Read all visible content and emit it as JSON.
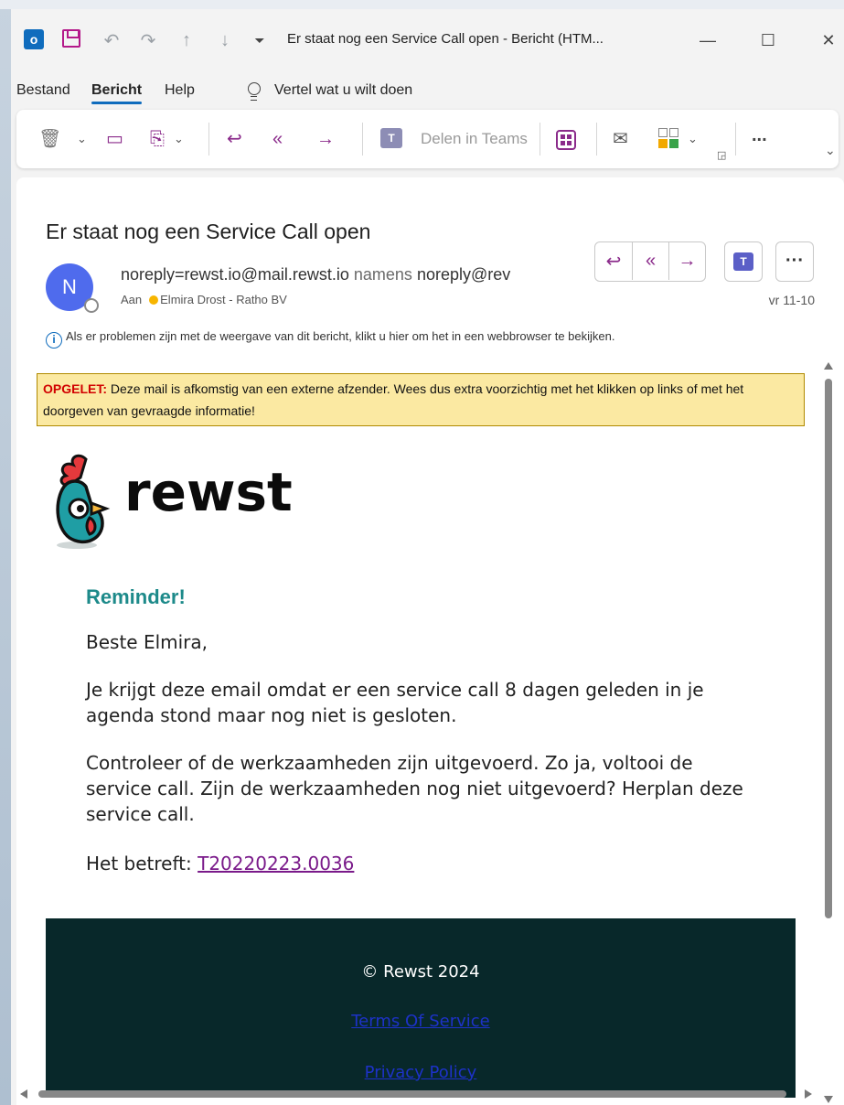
{
  "window": {
    "title": "Er staat nog een Service Call open  -  Bericht (HTM..."
  },
  "menu": {
    "items": [
      "Bestand",
      "Bericht",
      "Help"
    ],
    "tell_me": "Vertel wat u wilt doen"
  },
  "ribbon": {
    "share_teams_label": "Delen in Teams",
    "more_label": "..."
  },
  "message": {
    "subject": "Er staat nog een Service Call open",
    "avatar_initial": "N",
    "sender_address": "noreply=rewst.io@mail.rewst.io",
    "sender_on_behalf": "namens",
    "sender_behalf_address": "noreply@rev",
    "to_label": "Aan",
    "recipient": "Elmira Drost - Ratho BV",
    "date": "vr 11-10",
    "info_text": "Als er problemen zijn met de weergave van dit bericht, klikt u hier om het in een webbrowser te bekijken.",
    "info_icon": "i"
  },
  "body": {
    "warning_label": "OPGELET:",
    "warning_text": " Deze mail is afkomstig van een externe afzender. Wees dus extra voorzichtig met het klikken op links of met het doorgeven van gevraagde informatie!",
    "logo_text": "rewst",
    "heading": "Reminder!",
    "greeting": "Beste Elmira,",
    "para1": "Je krijgt deze email omdat er een service call 8 dagen geleden in je agenda stond maar nog niet is gesloten.",
    "para2": "Controleer of de werkzaamheden zijn uitgevoerd. Zo ja, voltooi de service call. Zijn de werkzaamheden nog niet uitgevoerd? Herplan deze service call.",
    "reference_label": "Het betreft: ",
    "reference_link": "T20220223.0036",
    "footer_copyright": "© Rewst 2024",
    "footer_terms": "Terms Of Service",
    "footer_privacy": "Privacy Policy"
  },
  "colors": {
    "accent": "#0f6cbd",
    "ribbon_icon": "#8b2b8b",
    "warning_bg": "#fbe9a2",
    "heading": "#1d8a8a",
    "footer_bg": "#08282a"
  }
}
